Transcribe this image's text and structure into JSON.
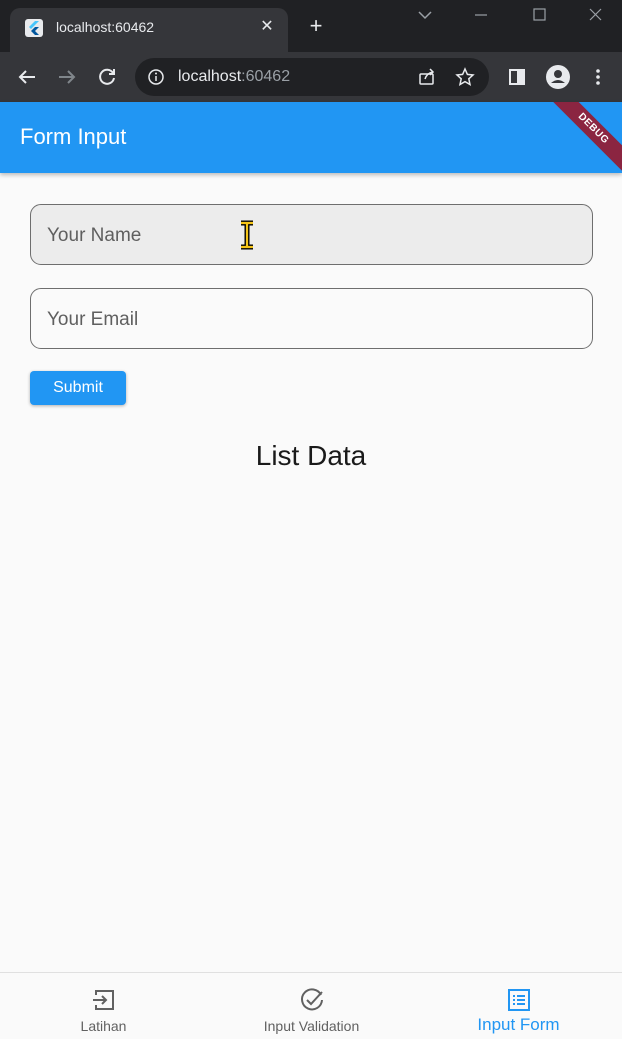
{
  "browser": {
    "tab_title": "localhost:60462",
    "url_host": "localhost",
    "url_port": ":60462"
  },
  "appbar": {
    "title": "Form Input",
    "debug_label": "DEBUG"
  },
  "form": {
    "name_placeholder": "Your Name",
    "name_value": "",
    "email_placeholder": "Your Email",
    "email_value": "",
    "submit_label": "Submit"
  },
  "list": {
    "title": "List Data",
    "items": []
  },
  "bottom_nav": {
    "items": [
      {
        "label": "Latihan",
        "icon": "login-icon",
        "active": false
      },
      {
        "label": "Input Validation",
        "icon": "check-circle-icon",
        "active": false
      },
      {
        "label": "Input Form",
        "icon": "list-alt-icon",
        "active": true
      }
    ]
  },
  "colors": {
    "primary": "#2196f3",
    "debug_banner": "#8b2541"
  }
}
